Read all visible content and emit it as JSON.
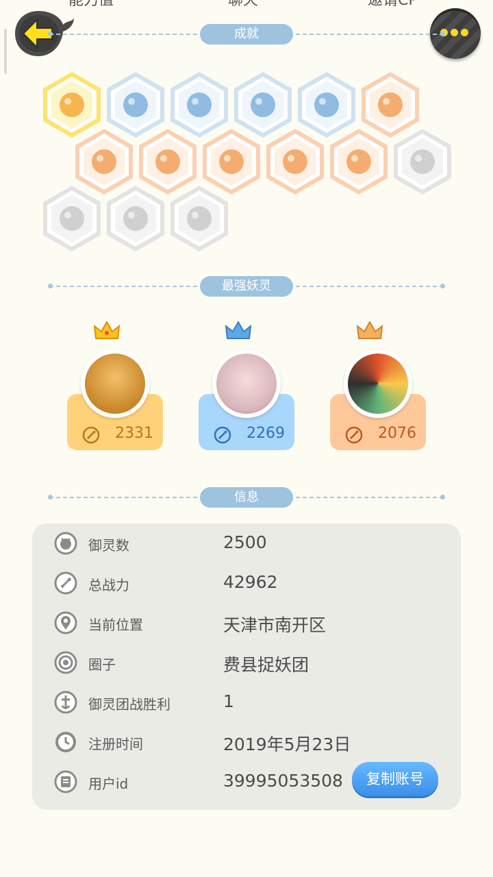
{
  "top_tabs": [
    "能力值",
    "聊天",
    "邀请CP"
  ],
  "header": {
    "back_icon": "back-arrow-icon",
    "more_icon": "more-dots-icon"
  },
  "sections": {
    "achievements": "成就",
    "strongest": "最强妖灵",
    "info": "信息"
  },
  "achievements": [
    {
      "name": "fox-spirit-badge",
      "style": "gold"
    },
    {
      "name": "sneaker-badge",
      "style": "blue"
    },
    {
      "name": "target-ring-badge",
      "style": "blue"
    },
    {
      "name": "cat-sparkle-badge",
      "style": "blue"
    },
    {
      "name": "yin-yang-scroll-badge",
      "style": "blue"
    },
    {
      "name": "moon-badge",
      "style": "orange"
    },
    {
      "name": "dumpling-badge",
      "style": "orange"
    },
    {
      "name": "egg-crystal-badge",
      "style": "orange"
    },
    {
      "name": "yin-yang-swirl-badge",
      "style": "orange"
    },
    {
      "name": "flower-spirit-badge",
      "style": "orange"
    },
    {
      "name": "fish-spirit-badge",
      "style": "orange"
    },
    {
      "name": "cat-cart-badge",
      "style": "locked"
    },
    {
      "name": "shield-badge",
      "style": "locked"
    },
    {
      "name": "horned-cat-badge",
      "style": "locked"
    },
    {
      "name": "cat-book-badge",
      "style": "locked"
    }
  ],
  "leaders": [
    {
      "rank": "gold",
      "power": "2331",
      "card_color": "#ffd27a",
      "text_color": "#b8741e"
    },
    {
      "rank": "blue",
      "power": "2269",
      "card_color": "#a9d6fb",
      "text_color": "#2f72b8"
    },
    {
      "rank": "bronze",
      "power": "2076",
      "card_color": "#ffc89a",
      "text_color": "#b85a1e"
    }
  ],
  "info_rows": [
    {
      "icon": "spirit-orb-icon",
      "label": "御灵数",
      "value": "2500"
    },
    {
      "icon": "sword-power-icon",
      "label": "总战力",
      "value": "42962"
    },
    {
      "icon": "location-pin-icon",
      "label": "当前位置",
      "value": "天津市南开区"
    },
    {
      "icon": "circle-group-icon",
      "label": "圈子",
      "value": "费县捉妖团"
    },
    {
      "icon": "victory-icon",
      "label": "御灵团战胜利",
      "value": "1"
    },
    {
      "icon": "clock-icon",
      "label": "注册时间",
      "value": "2019年5月23日"
    },
    {
      "icon": "user-id-icon",
      "label": "用户id",
      "value": "39995053508"
    }
  ],
  "copy_button": "复制账号"
}
